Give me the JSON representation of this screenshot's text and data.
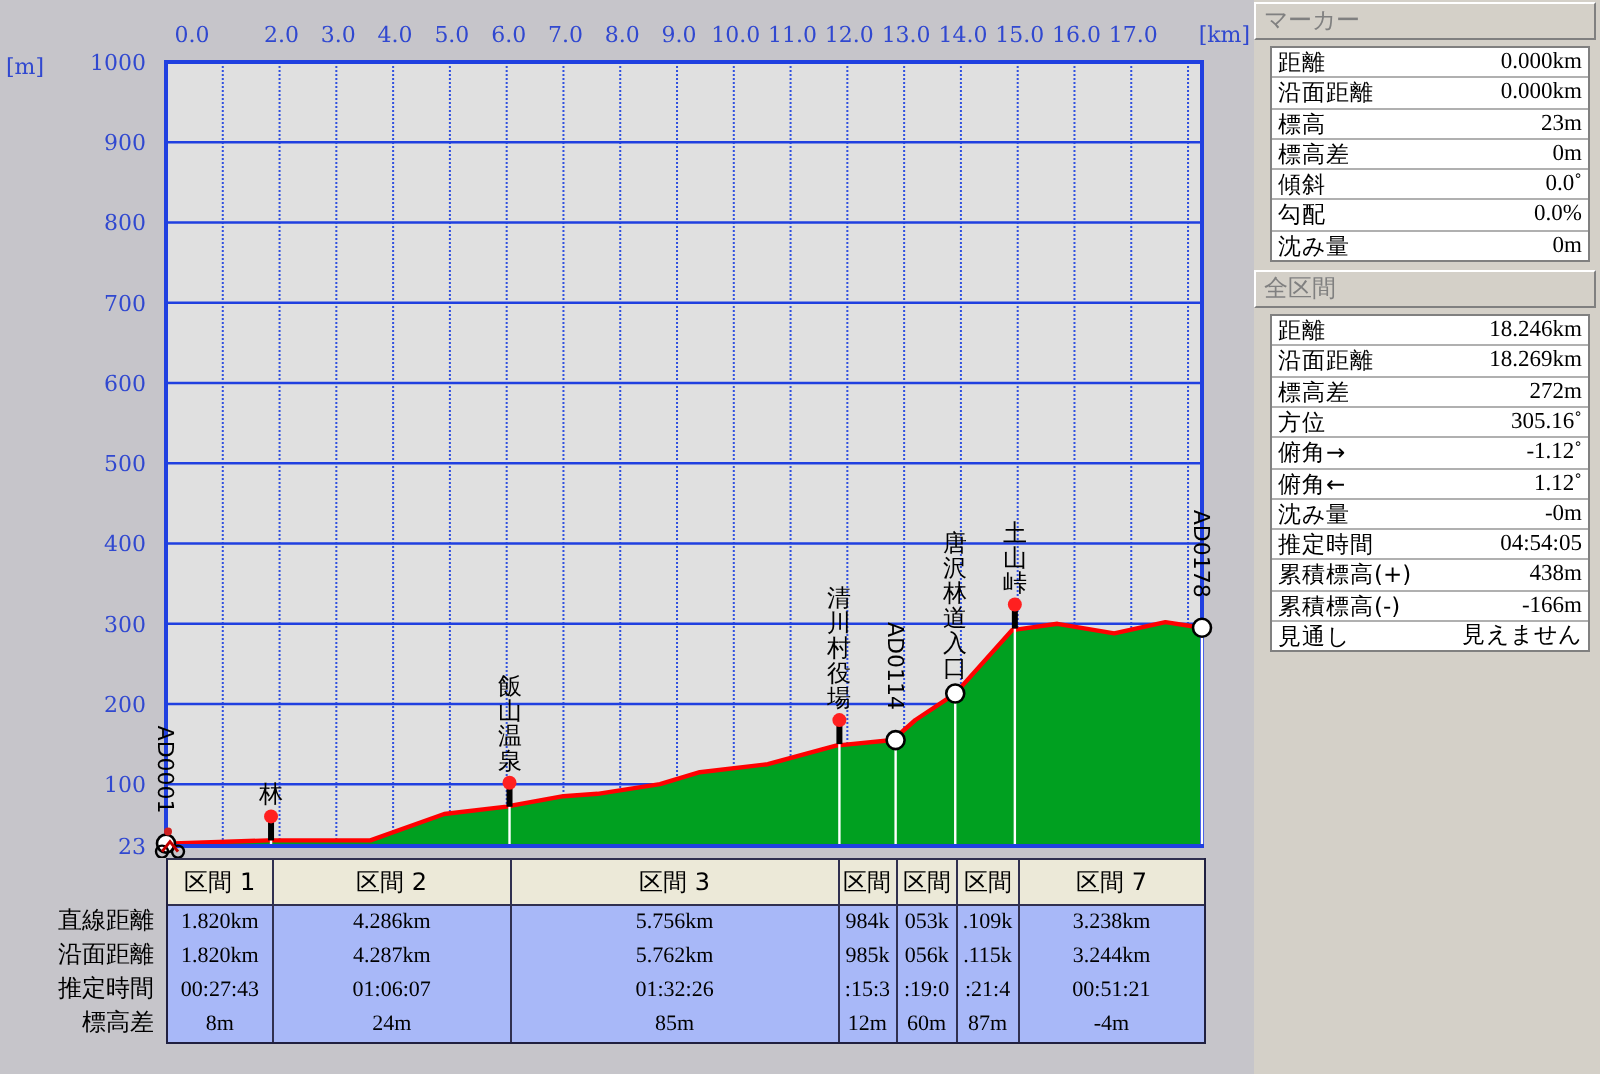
{
  "chart": {
    "x_unit": "[km]",
    "y_unit": "[m]",
    "chart_data": {
      "type": "area",
      "xlim": [
        0,
        18.246
      ],
      "ylim": [
        23,
        1000
      ],
      "xticks": [
        {
          "value": 0,
          "label": "0.0"
        },
        {
          "value": 2,
          "label": "2.0"
        },
        {
          "value": 3,
          "label": "3.0"
        },
        {
          "value": 4,
          "label": "4.0"
        },
        {
          "value": 5,
          "label": "5.0"
        },
        {
          "value": 6,
          "label": "6.0"
        },
        {
          "value": 7,
          "label": "7.0"
        },
        {
          "value": 8,
          "label": "8.0"
        },
        {
          "value": 9,
          "label": "9.0"
        },
        {
          "value": 10,
          "label": "10.0"
        },
        {
          "value": 11,
          "label": "11.0"
        },
        {
          "value": 12,
          "label": "12.0"
        },
        {
          "value": 13,
          "label": "13.0"
        },
        {
          "value": 14,
          "label": "14.0"
        },
        {
          "value": 15,
          "label": "15.0"
        },
        {
          "value": 16,
          "label": "16.0"
        },
        {
          "value": 17,
          "label": "17.0"
        }
      ],
      "yticks": [
        23,
        100,
        200,
        300,
        400,
        500,
        600,
        700,
        800,
        900,
        1000
      ],
      "x": [
        0,
        1.8,
        3.6,
        4.9,
        6.0,
        7.0,
        7.6,
        8.7,
        9.4,
        10.6,
        11.8,
        12.8,
        13.2,
        13.9,
        14.9,
        15.7,
        16.7,
        17.6,
        18.246
      ],
      "grid": true,
      "series": [
        {
          "color": "#00a020",
          "values": [
            26,
            30,
            30,
            63,
            72,
            85,
            88,
            100,
            115,
            125,
            148,
            155,
            180,
            213,
            292,
            300,
            288,
            302,
            295
          ]
        }
      ],
      "annotations": [
        {
          "x": 0,
          "y": 26,
          "text": "AD0001"
        },
        {
          "x": 1.85,
          "y": 30,
          "text": "林"
        },
        {
          "x": 6.05,
          "y": 72,
          "text": "飯山温泉"
        },
        {
          "x": 11.86,
          "y": 150,
          "text": "清川村役場"
        },
        {
          "x": 12.85,
          "y": 155,
          "text": "AD0114"
        },
        {
          "x": 13.9,
          "y": 213,
          "text": "唐沢林道入口"
        },
        {
          "x": 14.95,
          "y": 294,
          "text": "土山峠"
        },
        {
          "x": 18.246,
          "y": 295,
          "text": "AD0178"
        }
      ]
    },
    "markers": [
      {
        "kind": "waypoint",
        "rotated": true
      },
      {
        "kind": "pin",
        "rotated": false
      },
      {
        "kind": "pin",
        "rotated": false
      },
      {
        "kind": "pin",
        "rotated": false
      },
      {
        "kind": "waypoint",
        "rotated": true
      },
      {
        "kind": "waypoint",
        "rotated": false
      },
      {
        "kind": "pin",
        "rotated": false
      },
      {
        "kind": "waypoint",
        "rotated": true
      }
    ]
  },
  "sections": {
    "row_labels": [
      "直線距離",
      "沿面距離",
      "推定時間",
      "標高差"
    ],
    "columns": [
      {
        "header": "区間 1",
        "values": [
          "1.820km",
          "1.820km",
          "00:27:43",
          "8m"
        ]
      },
      {
        "header": "区間 2",
        "values": [
          "4.286km",
          "4.287km",
          "01:06:07",
          "24m"
        ]
      },
      {
        "header": "区間 3",
        "values": [
          "5.756km",
          "5.762km",
          "01:32:26",
          "85m"
        ]
      },
      {
        "header": "区間",
        "values": [
          "984k",
          "985k",
          ":15:3",
          "12m"
        ]
      },
      {
        "header": "区間",
        "values": [
          "053k",
          "056k",
          ":19:0",
          "60m"
        ]
      },
      {
        "header": "区間",
        "values": [
          ".109k",
          ".115k",
          ":21:4",
          "87m"
        ]
      },
      {
        "header": "区間 7",
        "values": [
          "3.238km",
          "3.244km",
          "00:51:21",
          "-4m"
        ]
      }
    ]
  },
  "marker_panel": {
    "title": "マーカー",
    "rows": [
      {
        "label": "距離",
        "value": "0.000km"
      },
      {
        "label": "沿面距離",
        "value": "0.000km"
      },
      {
        "label": "標高",
        "value": "23m"
      },
      {
        "label": "標高差",
        "value": "0m"
      },
      {
        "label": "傾斜",
        "value": "0.0˚"
      },
      {
        "label": "勾配",
        "value": "0.0%"
      },
      {
        "label": "沈み量",
        "value": "0m"
      }
    ]
  },
  "total_panel": {
    "title": "全区間",
    "rows": [
      {
        "label": "距離",
        "value": "18.246km"
      },
      {
        "label": "沿面距離",
        "value": "18.269km"
      },
      {
        "label": "標高差",
        "value": "272m"
      },
      {
        "label": "方位",
        "value": "305.16˚"
      },
      {
        "label": "俯角→",
        "value": "-1.12˚"
      },
      {
        "label": "俯角←",
        "value": "1.12˚"
      },
      {
        "label": "沈み量",
        "value": "-0m"
      },
      {
        "label": "推定時間",
        "value": "04:54:05"
      },
      {
        "label": "累積標高(+)",
        "value": "438m"
      },
      {
        "label": "累積標高(-)",
        "value": "-166m"
      },
      {
        "label": "見通し",
        "value": "見えません"
      }
    ]
  }
}
